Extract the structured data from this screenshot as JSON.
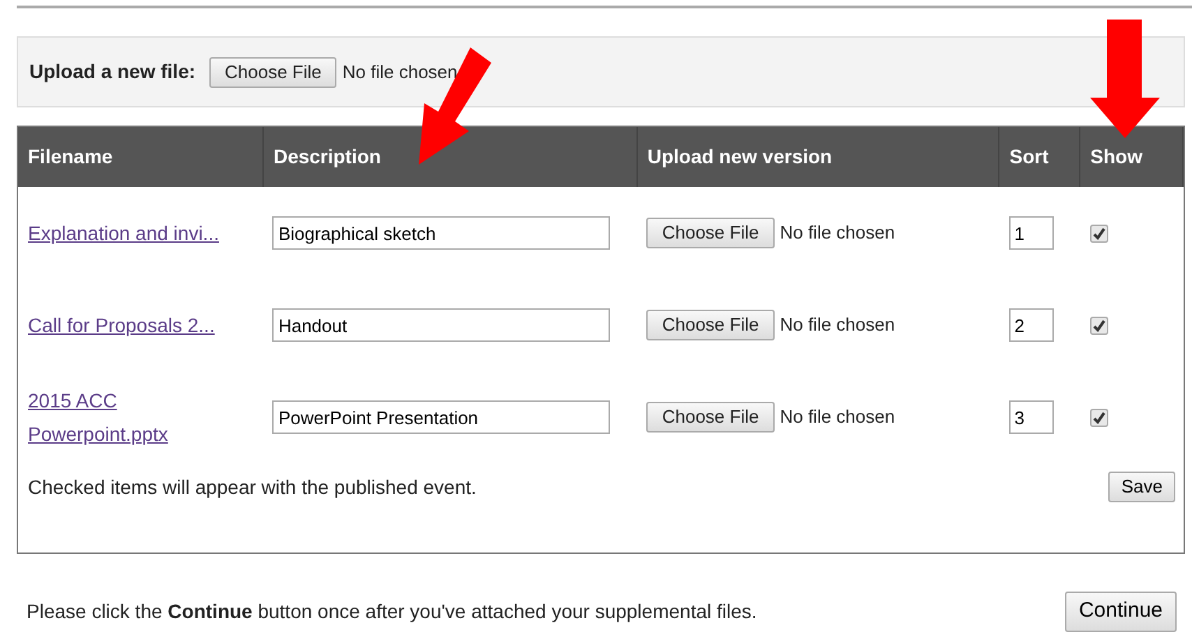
{
  "upload": {
    "label": "Upload a new file:",
    "button": "Choose File",
    "status": "No file chosen"
  },
  "table": {
    "columns": [
      "Filename",
      "Description",
      "Upload new version",
      "Sort",
      "Show"
    ],
    "rows": [
      {
        "filename": "Explanation and invi...",
        "description": "Biographical sketch",
        "button": "Choose File",
        "status": "No file chosen",
        "sort": "1",
        "show": true
      },
      {
        "filename": "Call for Proposals 2...",
        "description": "Handout",
        "button": "Choose File",
        "status": "No file chosen",
        "sort": "2",
        "show": true
      },
      {
        "filename": "2015 ACC Powerpoint.pptx",
        "description": "PowerPoint Presentation",
        "button": "Choose File",
        "status": "No file chosen",
        "sort": "3",
        "show": true
      }
    ],
    "note": "Checked items will appear with the published event.",
    "save": "Save"
  },
  "instruction": "Please click the **Continue** button once after you've attached your supplemental files.",
  "continue": "Continue"
}
